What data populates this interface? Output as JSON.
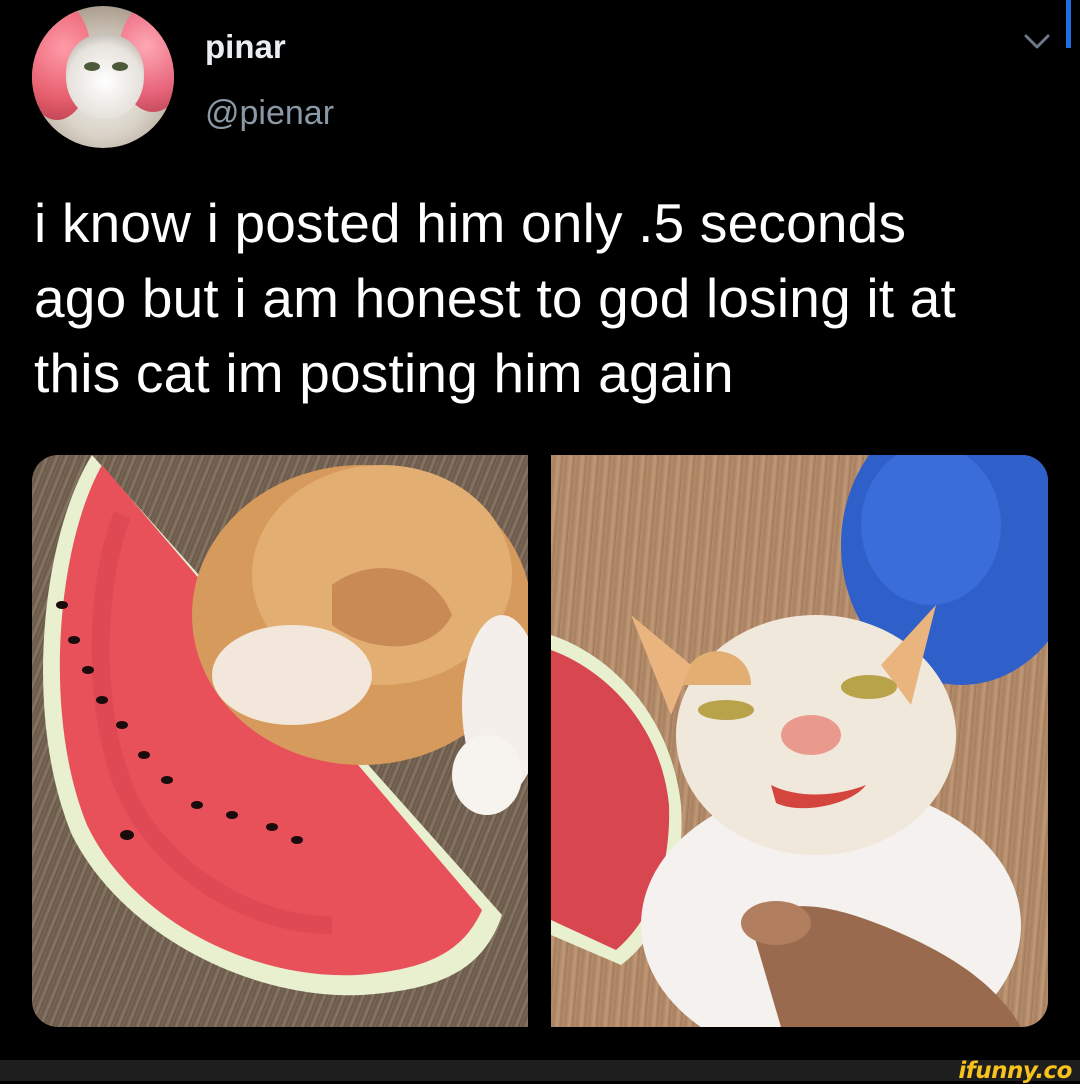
{
  "tweet": {
    "display_name": "pinar",
    "handle": "@pienar",
    "text_lines": [
      "i know i posted him only .5 seconds",
      "ago but i am honest to god losing it at",
      "this cat im posting him again"
    ]
  },
  "icons": {
    "menu": "chevron-down-icon",
    "avatar": "avatar"
  },
  "watermark": "ifunny.co",
  "colors": {
    "background": "#000000",
    "text": "#ffffff",
    "handle": "#8b98a5",
    "watermark": "#f6c21b"
  }
}
